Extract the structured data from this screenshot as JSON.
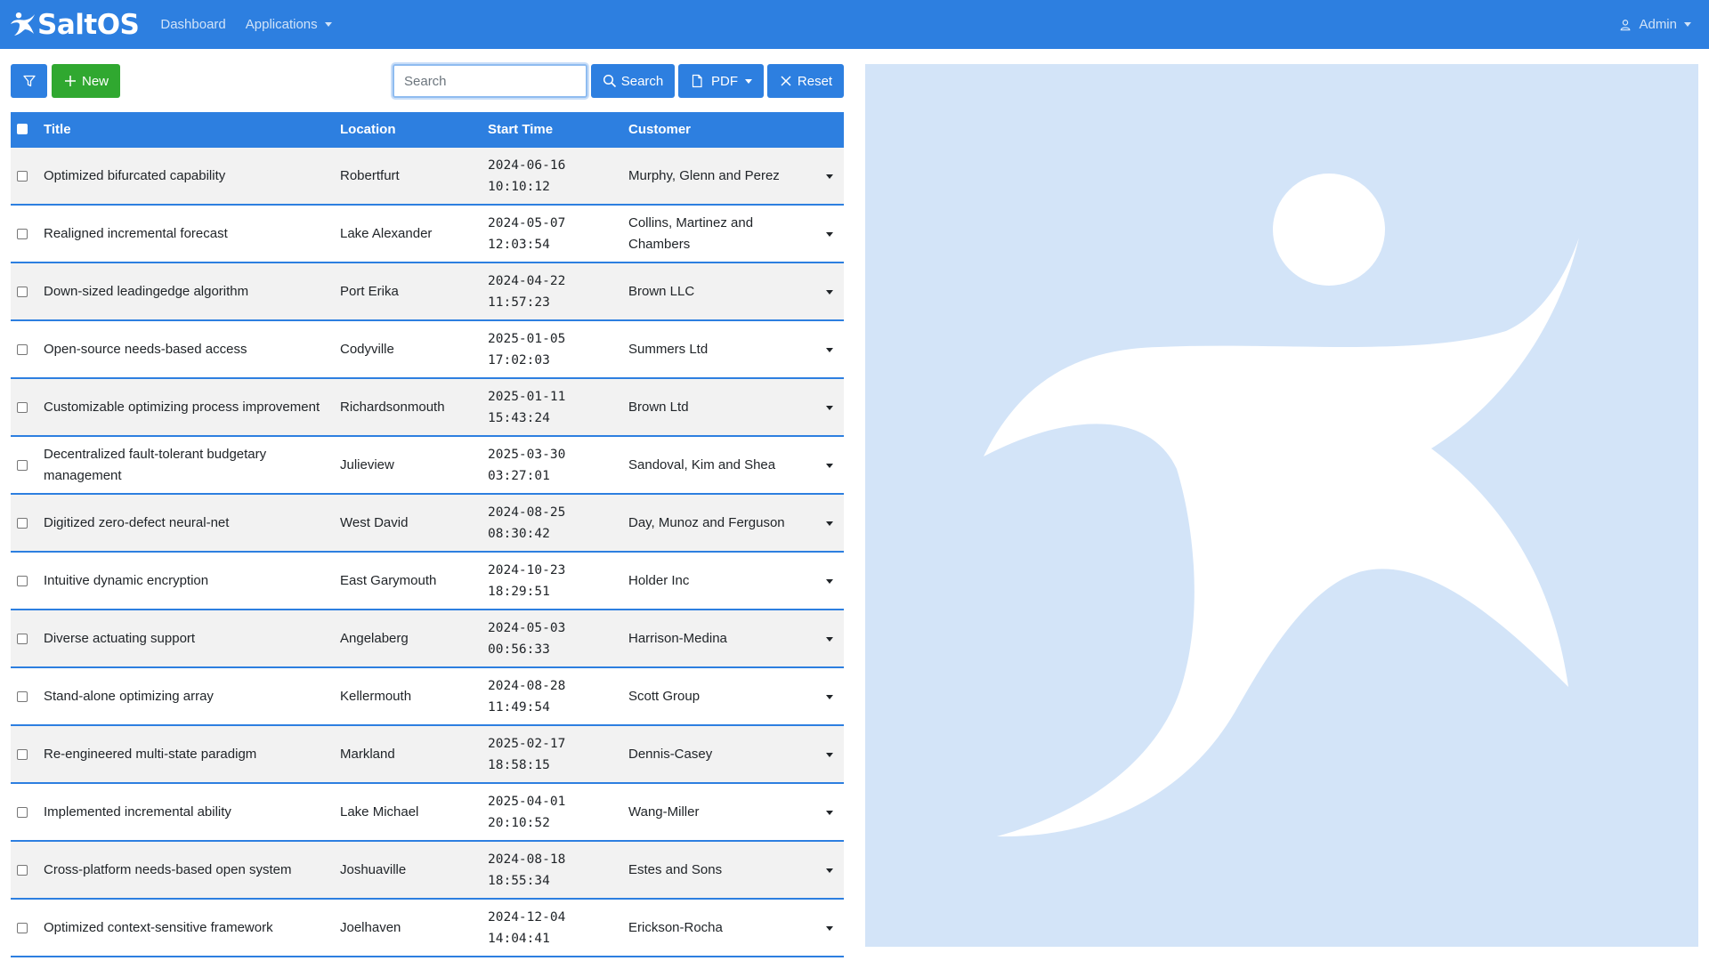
{
  "navbar": {
    "brand": "SaltOS",
    "links": [
      {
        "label": "Dashboard"
      },
      {
        "label": "Applications"
      }
    ],
    "user": "Admin"
  },
  "toolbar": {
    "new_label": "New",
    "search_placeholder": "Search",
    "search_label": "Search",
    "pdf_label": "PDF",
    "reset_label": "Reset"
  },
  "table": {
    "columns": [
      "Title",
      "Location",
      "Start Time",
      "Customer"
    ],
    "rows": [
      {
        "title": "Optimized bifurcated capability",
        "location": "Robertfurt",
        "date": "2024-06-16",
        "time": "10:10:12",
        "customer": "Murphy, Glenn and Perez"
      },
      {
        "title": "Realigned incremental forecast",
        "location": "Lake Alexander",
        "date": "2024-05-07",
        "time": "12:03:54",
        "customer": "Collins, Martinez and Chambers"
      },
      {
        "title": "Down-sized leadingedge algorithm",
        "location": "Port Erika",
        "date": "2024-04-22",
        "time": "11:57:23",
        "customer": "Brown LLC"
      },
      {
        "title": "Open-source needs-based access",
        "location": "Codyville",
        "date": "2025-01-05",
        "time": "17:02:03",
        "customer": "Summers Ltd"
      },
      {
        "title": "Customizable optimizing process improvement",
        "location": "Richardsonmouth",
        "date": "2025-01-11",
        "time": "15:43:24",
        "customer": "Brown Ltd"
      },
      {
        "title": "Decentralized fault-tolerant budgetary management",
        "location": "Julieview",
        "date": "2025-03-30",
        "time": "03:27:01",
        "customer": "Sandoval, Kim and Shea"
      },
      {
        "title": "Digitized zero-defect neural-net",
        "location": "West David",
        "date": "2024-08-25",
        "time": "08:30:42",
        "customer": "Day, Munoz and Ferguson"
      },
      {
        "title": "Intuitive dynamic encryption",
        "location": "East Garymouth",
        "date": "2024-10-23",
        "time": "18:29:51",
        "customer": "Holder Inc"
      },
      {
        "title": "Diverse actuating support",
        "location": "Angelaberg",
        "date": "2024-05-03",
        "time": "00:56:33",
        "customer": "Harrison-Medina"
      },
      {
        "title": "Stand-alone optimizing array",
        "location": "Kellermouth",
        "date": "2024-08-28",
        "time": "11:49:54",
        "customer": "Scott Group"
      },
      {
        "title": "Re-engineered multi-state paradigm",
        "location": "Markland",
        "date": "2025-02-17",
        "time": "18:58:15",
        "customer": "Dennis-Casey"
      },
      {
        "title": "Implemented incremental ability",
        "location": "Lake Michael",
        "date": "2025-04-01",
        "time": "20:10:52",
        "customer": "Wang-Miller"
      },
      {
        "title": "Cross-platform needs-based open system",
        "location": "Joshuaville",
        "date": "2024-08-18",
        "time": "18:55:34",
        "customer": "Estes and Sons"
      },
      {
        "title": "Optimized context-sensitive framework",
        "location": "Joelhaven",
        "date": "2024-12-04",
        "time": "14:04:41",
        "customer": "Erickson-Rocha"
      }
    ]
  },
  "colors": {
    "primary": "#2d7fe0",
    "success": "#30a830",
    "panel_bg": "#d3e4f8"
  },
  "icons": {
    "brand": "saltos-figure-icon",
    "filter": "funnel-icon",
    "new": "plus-icon",
    "search": "magnifier-icon",
    "pdf": "document-icon",
    "reset": "x-icon",
    "user": "person-icon"
  }
}
